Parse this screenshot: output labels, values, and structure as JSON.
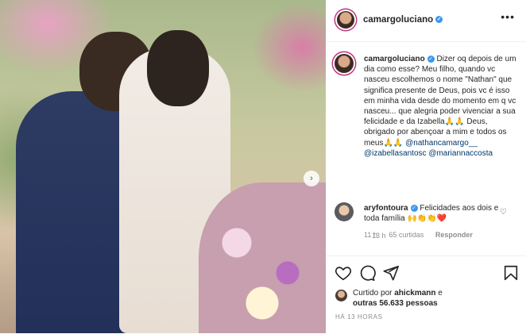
{
  "post": {
    "username": "camargoluciano",
    "more_label": "•••"
  },
  "caption": {
    "username": "camargoluciano",
    "text": "Dizer oq depois de um dia como esse? Meu filho, quando vc nasceu escolhemos o nome \"Nathan\" que significa presente de Deus, pois vc é isso em minha vida desde do momento em q vc nasceu... que alegria poder vivenciar a sua felicidade e da Izabella🙏🙏 Deus, obrigado por abençoar a mim e todos os meus🙏🙏",
    "mentions": [
      "@nathancamargo__",
      "@izabellasantosc",
      "@mariannaccosta"
    ],
    "time": "13 h"
  },
  "comment": {
    "username": "aryfontoura",
    "text": "Felicidades aos dois e toda família 🙌👏👏❤️",
    "time": "11 h",
    "likes": "65 curtidas",
    "reply_label": "Responder"
  },
  "likes": {
    "prefix": "Curtido por",
    "user": "ahickmann",
    "mid": "e",
    "others": "outras 56.633 pessoas"
  },
  "post_time": "HÁ 13 HORAS",
  "icons": [
    "heart-icon",
    "comment-icon",
    "share-icon",
    "bookmark-icon",
    "more-icon",
    "verified-icon",
    "chevron-right-icon"
  ],
  "colors": {
    "verified": "#3897f0",
    "mention": "#00376b",
    "muted": "#8e8e8e"
  }
}
